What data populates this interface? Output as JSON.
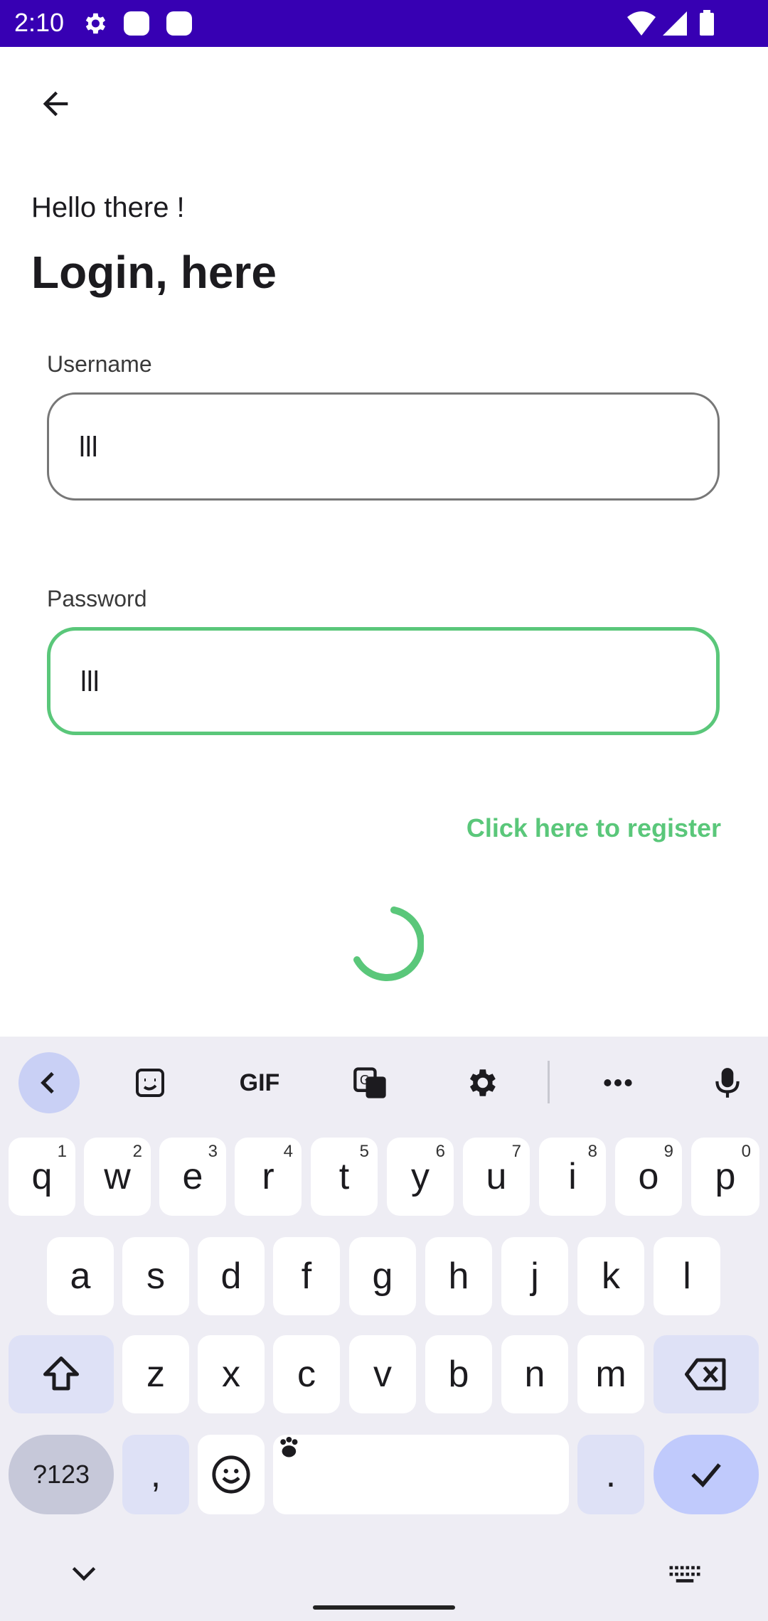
{
  "status": {
    "time": "2:10"
  },
  "login": {
    "greeting": "Hello there !",
    "title": "Login, here",
    "username_label": "Username",
    "username_value": "lll",
    "password_label": "Password",
    "password_value": "lll",
    "register_link": "Click here to register",
    "accent": "#5ac77a"
  },
  "keyboard": {
    "toolbar": [
      "back-icon",
      "sticker-icon",
      "GIF",
      "translate-icon",
      "settings-icon",
      "more-icon",
      "mic-icon"
    ],
    "gif_label": "GIF",
    "row1": [
      {
        "k": "q",
        "n": "1"
      },
      {
        "k": "w",
        "n": "2"
      },
      {
        "k": "e",
        "n": "3"
      },
      {
        "k": "r",
        "n": "4"
      },
      {
        "k": "t",
        "n": "5"
      },
      {
        "k": "y",
        "n": "6"
      },
      {
        "k": "u",
        "n": "7"
      },
      {
        "k": "i",
        "n": "8"
      },
      {
        "k": "o",
        "n": "9"
      },
      {
        "k": "p",
        "n": "0"
      }
    ],
    "row2": [
      "a",
      "s",
      "d",
      "f",
      "g",
      "h",
      "j",
      "k",
      "l"
    ],
    "row3": [
      "z",
      "x",
      "c",
      "v",
      "b",
      "n",
      "m"
    ],
    "symbols_label": "?123",
    "comma_label": ",",
    "period_label": "."
  }
}
